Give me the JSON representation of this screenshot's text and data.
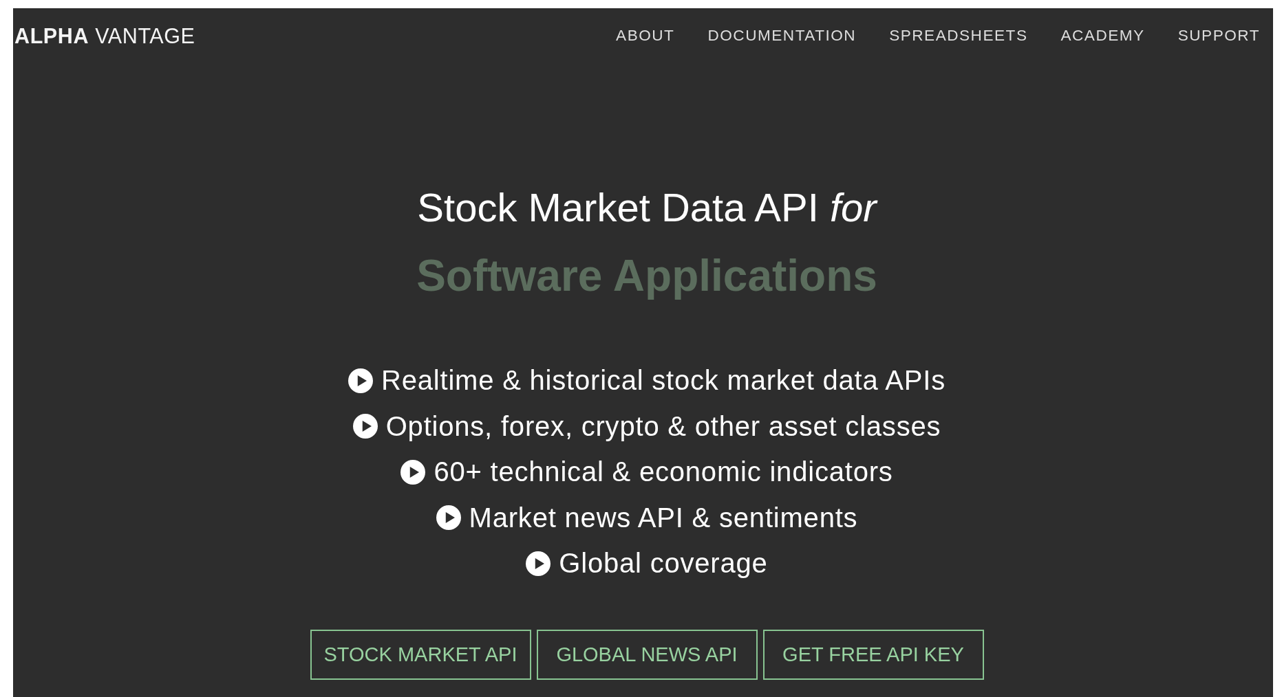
{
  "header": {
    "logo": "**ALPHA** VANTAGE",
    "nav": [
      "ABOUT",
      "DOCUMENTATION",
      "SPREADSHEETS",
      "ACADEMY",
      "SUPPORT"
    ]
  },
  "hero": {
    "title": "Stock Market Data API *for*",
    "subtitle": "Software Applications",
    "features": [
      "Realtime & historical stock market data APIs",
      "Options, forex, crypto & other asset classes",
      "60+ technical & economic indicators",
      "Market news API & sentiments",
      "Global coverage"
    ],
    "buttons": [
      "STOCK MARKET API",
      "GLOBAL NEWS API",
      "GET FREE API KEY"
    ]
  }
}
